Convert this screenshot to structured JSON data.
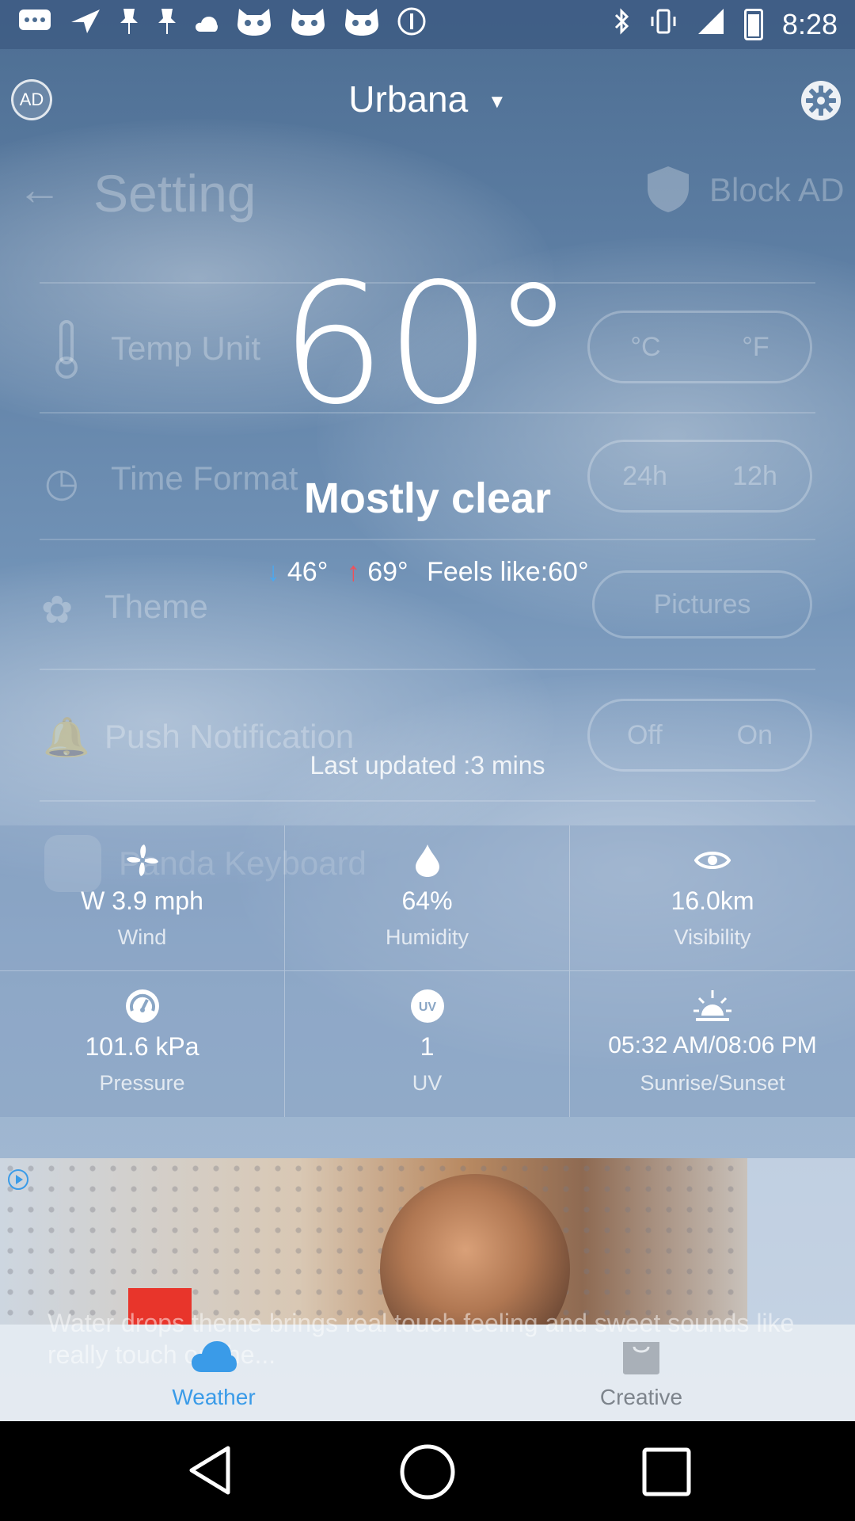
{
  "status_bar": {
    "time": "8:28",
    "left_icons": [
      "chat-icon",
      "navigation-icon",
      "pin-icon",
      "pin-icon",
      "cloud-icon",
      "cat-icon",
      "cat-icon",
      "cat-icon",
      "alert-icon"
    ],
    "right_icons": [
      "bluetooth-icon",
      "vibrate-icon",
      "signal-icon",
      "battery-icon"
    ]
  },
  "header": {
    "ad_label": "AD",
    "city": "Urbana",
    "city_dropdown_glyph": "▼",
    "settings_icon": "gear-icon"
  },
  "background_settings": {
    "title": "Setting",
    "block_ad": "Block AD",
    "rows": [
      {
        "label": "Temp Unit",
        "options": [
          "°C",
          "°F"
        ]
      },
      {
        "label": "Time Format",
        "options": [
          "24h",
          "12h"
        ]
      },
      {
        "label": "Theme",
        "options": [
          "Pictures"
        ]
      },
      {
        "label": "Push Notification",
        "options": [
          "Off",
          "On"
        ]
      },
      {
        "label": "Panda Keyboard",
        "options": []
      }
    ]
  },
  "weather": {
    "temperature": "60°",
    "condition": "Mostly clear",
    "low_arrow": "↓",
    "low": "46°",
    "high_arrow": "↑",
    "high": "69°",
    "feels_like": "Feels like:60°",
    "last_updated": "Last updated :3 mins"
  },
  "details": [
    {
      "icon": "fan-icon",
      "value": "W  3.9 mph",
      "label": "Wind"
    },
    {
      "icon": "droplet-icon",
      "value": "64%",
      "label": "Humidity"
    },
    {
      "icon": "eye-icon",
      "value": "16.0km",
      "label": "Visibility"
    },
    {
      "icon": "gauge-icon",
      "value": "101.6 kPa",
      "label": "Pressure"
    },
    {
      "icon": "uv-icon",
      "value": "1",
      "label": "UV"
    },
    {
      "icon": "sunrise-icon",
      "value": "05:32 AM/08:06 PM",
      "label": "Sunrise/Sunset"
    }
  ],
  "ad": {
    "text": "Water drops theme brings real touch feeling and sweet sounds like really touch on the..."
  },
  "bottom_nav": {
    "items": [
      {
        "label": "Weather",
        "icon": "cloud-icon",
        "active": true
      },
      {
        "label": "Creative",
        "icon": "bag-icon",
        "active": false
      }
    ]
  },
  "colors": {
    "active_tab": "#3a9be8",
    "inactive_tab": "#7d848c",
    "low_arrow": "#4aa8f0",
    "high_arrow": "#f0505a"
  }
}
